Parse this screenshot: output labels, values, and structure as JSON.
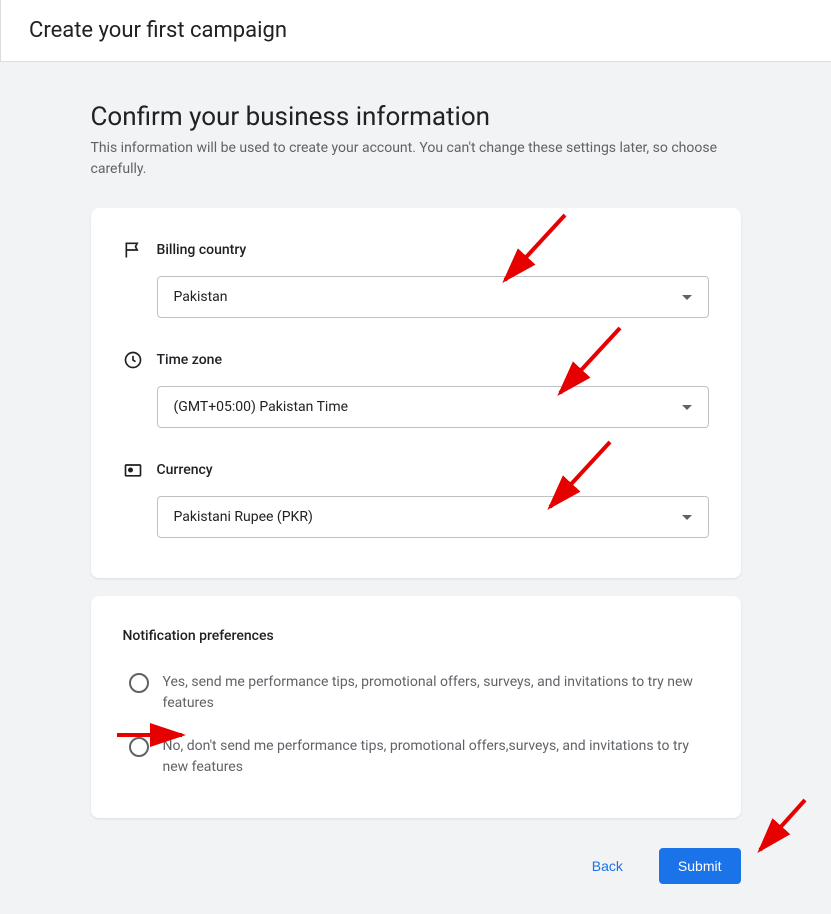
{
  "header": {
    "title": "Create your first campaign"
  },
  "page": {
    "title": "Confirm your business information",
    "description": "This information will be used to create your account. You can't change these settings later, so choose carefully."
  },
  "fields": {
    "billing": {
      "label": "Billing country",
      "value": "Pakistan"
    },
    "timezone": {
      "label": "Time zone",
      "value": "(GMT+05:00) Pakistan Time"
    },
    "currency": {
      "label": "Currency",
      "value": "Pakistani Rupee (PKR)"
    }
  },
  "notifications": {
    "title": "Notification preferences",
    "optionYes": "Yes, send me performance tips, promotional offers, surveys, and invitations to try new features",
    "optionNo": "No, don't send me performance tips, promotional offers,surveys, and invitations to try new features"
  },
  "actions": {
    "back": "Back",
    "submit": "Submit"
  }
}
